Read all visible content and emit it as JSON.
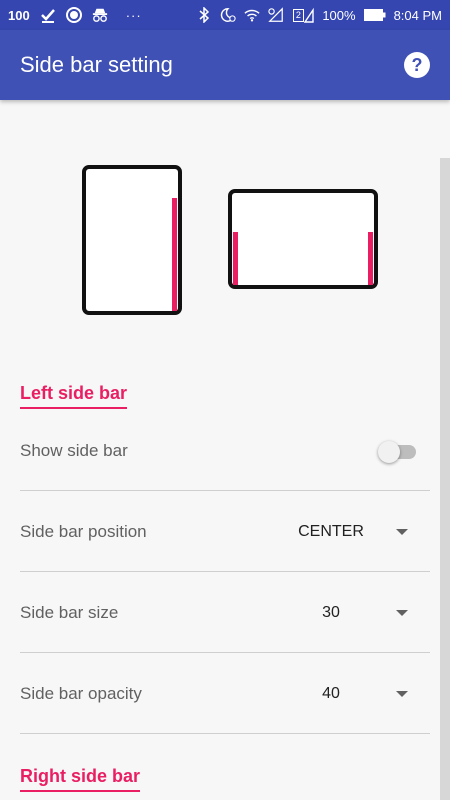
{
  "status_bar": {
    "battery_badge": "100",
    "battery_percent": "100%",
    "time": "8:04 PM",
    "dots": "···",
    "sim_badge": "2"
  },
  "app_bar": {
    "title": "Side bar setting",
    "help_icon": "help-icon"
  },
  "colors": {
    "status_bar": "#3546b0",
    "app_bar": "#3f51b5",
    "accent": "#e91e63",
    "background": "#f7f7f7"
  },
  "left_section": {
    "header": "Left side bar",
    "show_side_bar": {
      "label": "Show side bar",
      "enabled": false
    },
    "position": {
      "label": "Side bar position",
      "value": "CENTER"
    },
    "size": {
      "label": "Side bar size",
      "value": "30"
    },
    "opacity": {
      "label": "Side bar opacity",
      "value": "40"
    }
  },
  "right_section": {
    "header": "Right side bar"
  }
}
